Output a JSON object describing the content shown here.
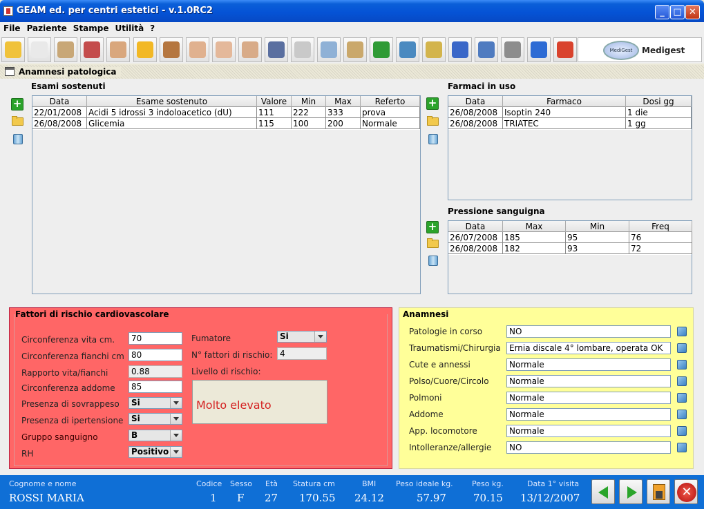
{
  "window": {
    "title": "GEAM ed. per centri estetici - v.1.0RC2",
    "minimize": "_",
    "maximize": "□",
    "close": "✕"
  },
  "menu": [
    "File",
    "Paziente",
    "Stampe",
    "Utilità",
    "?"
  ],
  "toolbar": {
    "icons": [
      "open-folder-icon",
      "document-icon",
      "vitruvian-man-icon",
      "caduceus-icon",
      "massage-icon",
      "measuring-tape-icon",
      "face-icon",
      "body-front-icon",
      "torso-icon",
      "legs-icon",
      "calculator-icon",
      "euro-icon",
      "magnifier-icon",
      "book-icon",
      "pharmacy-cross-icon",
      "notepad-icon",
      "emblem-icon",
      "email-icon",
      "agenda-icon",
      "printer-icon",
      "help-icon",
      "power-icon"
    ],
    "colors": [
      "#F0C23A",
      "#e9e9e9",
      "#c8a777",
      "#c44d4d",
      "#d9a77d",
      "#f2b825",
      "#b5763f",
      "#e0b18f",
      "#e4b89a",
      "#d8ab88",
      "#5a6fa0",
      "#c9c9c9",
      "#8fb1d6",
      "#caa86b",
      "#2F9B35",
      "#4b8ac0",
      "#d3b44c",
      "#3a67c8",
      "#4f7bc0",
      "#8d8d8d",
      "#2D6BD4",
      "#D9432E"
    ],
    "brand": "Medigest",
    "brand_logo": "MediGest"
  },
  "section": {
    "title": "Anamnesi patologica"
  },
  "exams": {
    "title": "Esami sostenuti",
    "headers": [
      "Data",
      "Esame sostenuto",
      "Valore",
      "Min",
      "Max",
      "Referto"
    ],
    "rows": [
      [
        "22/01/2008",
        "Acidi 5 idrossi 3 indoloacetico (dU)",
        "111",
        "222",
        "333",
        "prova"
      ],
      [
        "26/08/2008",
        "Glicemia",
        "115",
        "100",
        "200",
        "Normale"
      ]
    ]
  },
  "drugs": {
    "title": "Farmaci in uso",
    "headers": [
      "Data",
      "Farmaco",
      "Dosi gg"
    ],
    "rows": [
      [
        "26/08/2008",
        "Isoptin 240",
        "1 die"
      ],
      [
        "26/08/2008",
        "TRIATEC",
        "1 gg"
      ]
    ]
  },
  "pressure": {
    "title": "Pressione sanguigna",
    "headers": [
      "Data",
      "Max",
      "Min",
      "Freq"
    ],
    "rows": [
      [
        "26/07/2008",
        "185",
        "95",
        "76"
      ],
      [
        "26/08/2008",
        "182",
        "93",
        "72"
      ]
    ]
  },
  "risk": {
    "title": "Fattori di rischio cardiovascolare",
    "waist_label": "Circonferenza vita cm.",
    "waist": "70",
    "hips_label": "Circonferenza fianchi cm",
    "hips": "80",
    "ratio_label": "Rapporto vita/fianchi",
    "ratio": "0.88",
    "abdomen_label": "Circonferenza addome",
    "abdomen": "85",
    "overweight_label": "Presenza di sovrappeso",
    "overweight": "Si",
    "hypertension_label": "Presenza di ipertensione",
    "hypertension": "Si",
    "blood_group_label": "Gruppo sanguigno",
    "blood_group": "B",
    "rh_label": "RH",
    "rh": "Positivo",
    "smoker_label": "Fumatore",
    "smoker": "Si",
    "factors_label": "N° fattori di rischio:",
    "factors": "4",
    "level_label": "Livello di rischio:",
    "level": "Molto elevato"
  },
  "anamnesi": {
    "title": "Anamnesi",
    "fields": [
      {
        "label": "Patologie in corso",
        "value": "NO"
      },
      {
        "label": "Traumatismi/Chirurgia",
        "value": "Ernia discale 4° lombare, operata OK"
      },
      {
        "label": "Cute e annessi",
        "value": "Normale"
      },
      {
        "label": "Polso/Cuore/Circolo",
        "value": "Normale"
      },
      {
        "label": "Polmoni",
        "value": "Normale"
      },
      {
        "label": "Addome",
        "value": "Normale"
      },
      {
        "label": "App. locomotore",
        "value": "Normale"
      },
      {
        "label": "Intolleranze/allergie",
        "value": "NO"
      }
    ]
  },
  "status": {
    "name_label": "Cognome e nome",
    "name": "ROSSI MARIA",
    "code_label": "Codice",
    "code": "1",
    "sex_label": "Sesso",
    "sex": "F",
    "age_label": "Età",
    "age": "27",
    "height_label": "Statura cm",
    "height": "170.55",
    "bmi_label": "BMI",
    "bmi": "24.12",
    "ideal_label": "Peso ideale  kg.",
    "ideal": "57.97",
    "weight_label": "Peso kg.",
    "weight": "70.15",
    "first_visit_label": "Data 1° visita",
    "first_visit": "13/12/2007"
  }
}
